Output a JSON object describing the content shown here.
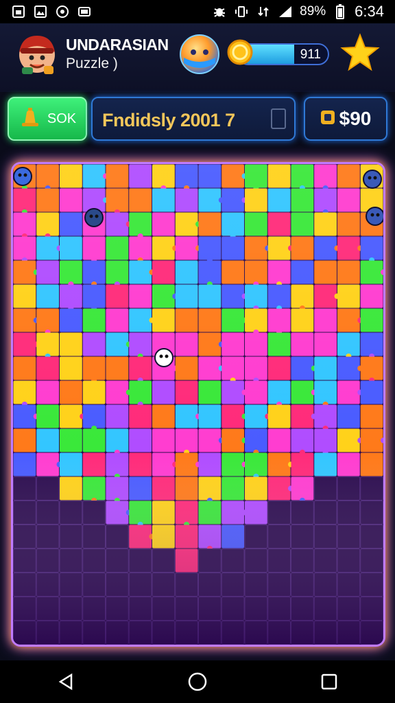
{
  "status_bar": {
    "battery": "89%",
    "time": "6:34",
    "left_icons": [
      "gallery-icon",
      "image-icon",
      "whatsapp-icon",
      "tv-icon"
    ],
    "right_icons": [
      "bug-icon",
      "vibrate-icon",
      "data-icon",
      "signal-icon"
    ]
  },
  "header": {
    "player_name": "UNDARASIAN",
    "player_sub": "Puzzle )",
    "coins": "911",
    "coin_progress": 0.62
  },
  "toolbar": {
    "sok_label": "SOK",
    "level_text": "Fndidsly 2001 7",
    "money": "$90"
  },
  "board": {
    "columns": 16,
    "rows": 20,
    "piece_colors": [
      "#ff3dd0",
      "#3ae83a",
      "#33c6ff",
      "#ff7a1a",
      "#ffd21a",
      "#b04dff",
      "#ff2b7a",
      "#4a5cff"
    ],
    "empty_color": "#2c0d4f"
  },
  "nav": {
    "back": "back-icon",
    "home": "home-icon",
    "recents": "recents-icon"
  }
}
